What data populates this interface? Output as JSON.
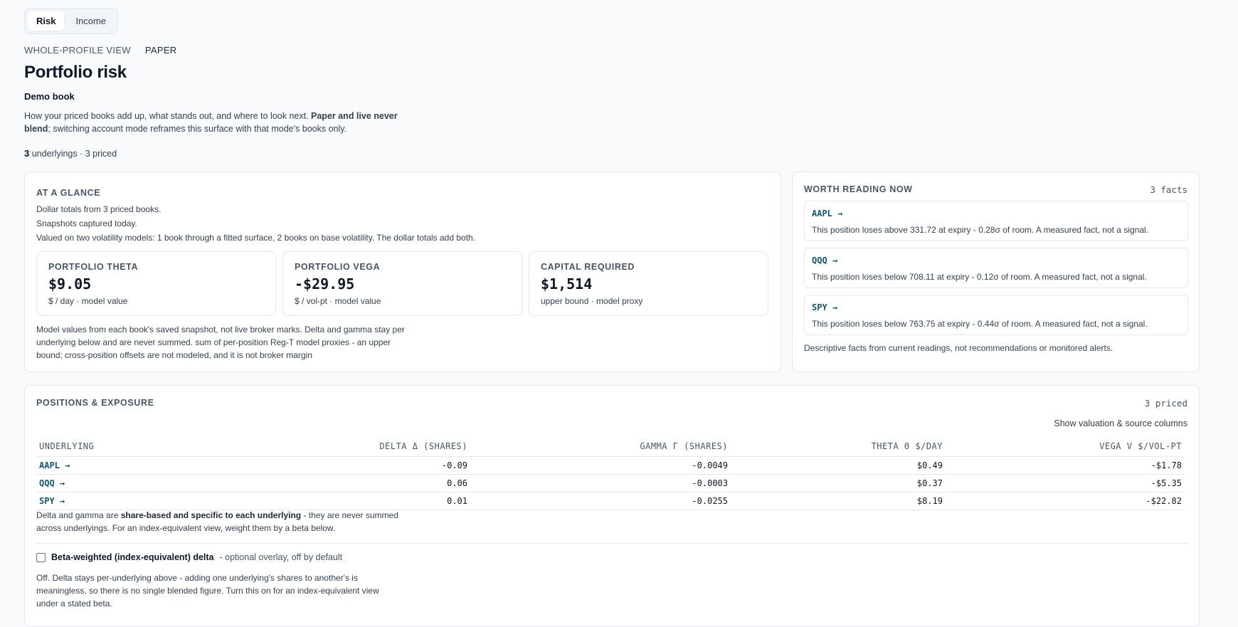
{
  "tabs": [
    {
      "label": "Risk",
      "active": true
    },
    {
      "label": "Income",
      "active": false
    }
  ],
  "eyebrow": {
    "view": "WHOLE-PROFILE VIEW",
    "mode": "PAPER"
  },
  "title": "Portfolio risk",
  "book_name": "Demo book",
  "description": {
    "before": "How your priced books add up, what stands out, and where to look next. ",
    "bold": "Paper and live never blend",
    "after": "; switching account mode reframes this surface with that mode's books only."
  },
  "counts": {
    "underlyings_num": "3",
    "rest": " underlyings · 3 priced"
  },
  "glance": {
    "title": "AT A GLANCE",
    "lines": [
      "Dollar totals from 3 priced books.",
      "Snapshots captured today.",
      "Valued on two volatility models: 1 book through a fitted surface, 2 books on base volatility. The dollar totals add both."
    ],
    "metrics": [
      {
        "label": "PORTFOLIO THETA",
        "value": "$9.05",
        "sub": "$ / day · model value"
      },
      {
        "label": "PORTFOLIO VEGA",
        "value": "-$29.95",
        "sub": "$ / vol-pt · model value"
      },
      {
        "label": "CAPITAL REQUIRED",
        "value": "$1,514",
        "sub": "upper bound · model proxy"
      }
    ],
    "note": "Model values from each book's saved snapshot, not live broker marks. Delta and gamma stay per underlying below and are never summed. sum of per-position Reg-T model proxies - an upper bound; cross-position offsets are not modeled, and it is not broker margin"
  },
  "worth": {
    "title": "WORTH READING NOW",
    "count": "3 facts",
    "facts": [
      {
        "ticker": "AAPL →",
        "text": "This position loses above 331.72 at expiry - 0.28σ of room. A measured fact, not a signal."
      },
      {
        "ticker": "QQQ →",
        "text": "This position loses below 708.11 at expiry - 0.12σ of room. A measured fact, not a signal."
      },
      {
        "ticker": "SPY →",
        "text": "This position loses below 763.75 at expiry - 0.44σ of room. A measured fact, not a signal."
      }
    ],
    "footer": "Descriptive facts from current readings, not recommendations or monitored alerts."
  },
  "positions": {
    "title": "POSITIONS & EXPOSURE",
    "priced": "3 priced",
    "show_columns": "Show valuation & source columns",
    "headers": [
      "UNDERLYING",
      "DELTA Δ (SHARES)",
      "GAMMA Γ (SHARES)",
      "THETA Θ $/DAY",
      "VEGA V $/VOL-PT"
    ],
    "rows": [
      [
        "AAPL →",
        "-0.09",
        "-0.0049",
        "$0.49",
        "-$1.78"
      ],
      [
        "QQQ →",
        "0.06",
        "-0.0003",
        "$0.37",
        "-$5.35"
      ],
      [
        "SPY →",
        "0.01",
        "-0.0255",
        "$8.19",
        "-$22.82"
      ]
    ],
    "note": {
      "before": "Delta and gamma are ",
      "bold": "share-based and specific to each underlying",
      "after": " - they are never summed across underlyings. For an index-equivalent view, weight them by a beta below."
    },
    "beta": {
      "label": "Beta-weighted (index-equivalent) delta",
      "hint": "- optional overlay, off by default",
      "note": "Off. Delta stays per-underlying above - adding one underlying's shares to another's is meaningless, so there is no single blended figure. Turn this on for an index-equivalent view under a stated beta."
    }
  }
}
